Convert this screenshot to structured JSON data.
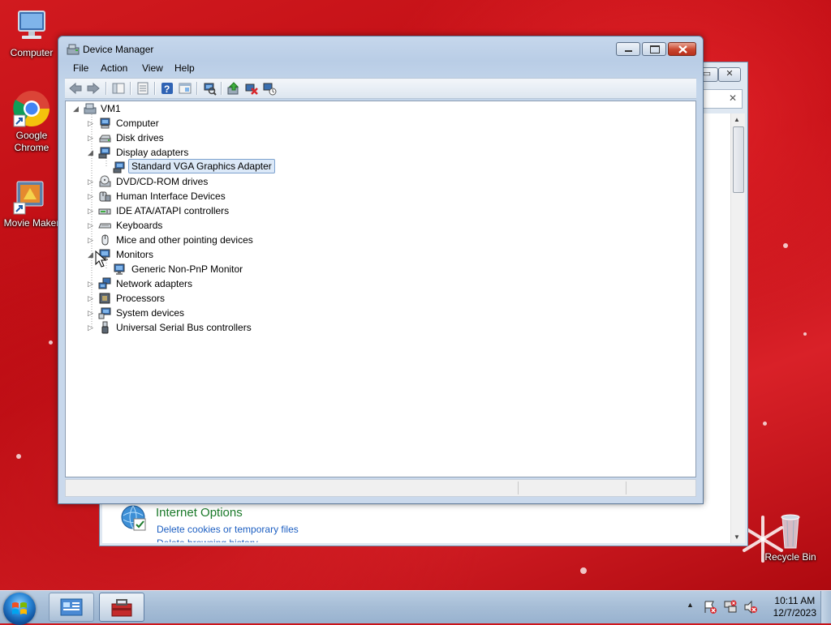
{
  "desktop": {
    "icons": [
      {
        "label": "Computer"
      },
      {
        "label": "Google Chrome"
      },
      {
        "label": "Movie Maker"
      },
      {
        "label": "Recycle Bin"
      }
    ]
  },
  "background_window": {
    "heading": "Internet Options",
    "link1": "Delete cookies or temporary files",
    "link2": "Delete browsing history",
    "close_search_glyph": "✕"
  },
  "window": {
    "title": "Device Manager",
    "menu": [
      "File",
      "Action",
      "View",
      "Help"
    ]
  },
  "tree": {
    "root": "VM1",
    "categories": [
      {
        "label": "Computer",
        "expanded": false
      },
      {
        "label": "Disk drives",
        "expanded": false
      },
      {
        "label": "Display adapters",
        "expanded": true
      },
      {
        "label": "Standard VGA Graphics Adapter",
        "child": true,
        "selected": true
      },
      {
        "label": "DVD/CD-ROM drives",
        "expanded": false
      },
      {
        "label": "Human Interface Devices",
        "expanded": false
      },
      {
        "label": "IDE ATA/ATAPI controllers",
        "expanded": false
      },
      {
        "label": "Keyboards",
        "expanded": false
      },
      {
        "label": "Mice and other pointing devices",
        "expanded": false
      },
      {
        "label": "Monitors",
        "expanded": true
      },
      {
        "label": "Generic Non-PnP Monitor",
        "child": true
      },
      {
        "label": "Network adapters",
        "expanded": false
      },
      {
        "label": "Processors",
        "expanded": false
      },
      {
        "label": "System devices",
        "expanded": false
      },
      {
        "label": "Universal Serial Bus controllers",
        "expanded": false
      }
    ]
  },
  "taskbar": {
    "time": "10:11 AM",
    "date": "12/7/2023"
  },
  "colors": {
    "accent": "#1e5aa6",
    "link": "#1d5fc2",
    "heading_green": "#1b7a2a"
  }
}
